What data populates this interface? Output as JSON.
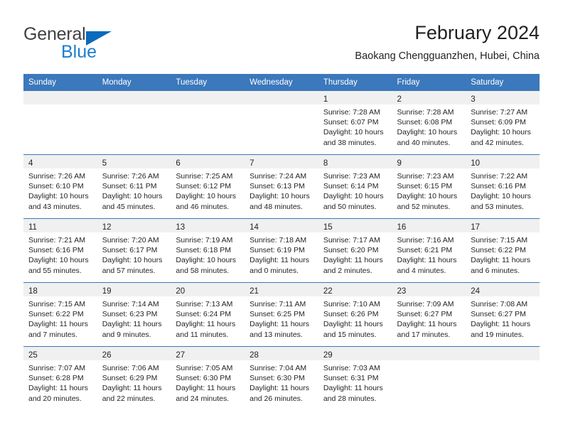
{
  "brand": {
    "name_part1": "General",
    "name_part2": "Blue",
    "triangle_color": "#0a6bbd",
    "blue_color": "#1a7ed0",
    "gray_color": "#414042"
  },
  "header": {
    "title": "February 2024",
    "subtitle": "Baokang Chengguanzhen, Hubei, China",
    "accent_color": "#3b78bc"
  },
  "weekday_headers": [
    "Sunday",
    "Monday",
    "Tuesday",
    "Wednesday",
    "Thursday",
    "Friday",
    "Saturday"
  ],
  "weeks": [
    [
      {
        "day": "",
        "lines": [],
        "empty": true
      },
      {
        "day": "",
        "lines": [],
        "empty": true
      },
      {
        "day": "",
        "lines": [],
        "empty": true
      },
      {
        "day": "",
        "lines": [],
        "empty": true
      },
      {
        "day": "1",
        "lines": [
          "Sunrise: 7:28 AM",
          "Sunset: 6:07 PM",
          "Daylight: 10 hours",
          "and 38 minutes."
        ],
        "empty": false
      },
      {
        "day": "2",
        "lines": [
          "Sunrise: 7:28 AM",
          "Sunset: 6:08 PM",
          "Daylight: 10 hours",
          "and 40 minutes."
        ],
        "empty": false
      },
      {
        "day": "3",
        "lines": [
          "Sunrise: 7:27 AM",
          "Sunset: 6:09 PM",
          "Daylight: 10 hours",
          "and 42 minutes."
        ],
        "empty": false
      }
    ],
    [
      {
        "day": "4",
        "lines": [
          "Sunrise: 7:26 AM",
          "Sunset: 6:10 PM",
          "Daylight: 10 hours",
          "and 43 minutes."
        ],
        "empty": false
      },
      {
        "day": "5",
        "lines": [
          "Sunrise: 7:26 AM",
          "Sunset: 6:11 PM",
          "Daylight: 10 hours",
          "and 45 minutes."
        ],
        "empty": false
      },
      {
        "day": "6",
        "lines": [
          "Sunrise: 7:25 AM",
          "Sunset: 6:12 PM",
          "Daylight: 10 hours",
          "and 46 minutes."
        ],
        "empty": false
      },
      {
        "day": "7",
        "lines": [
          "Sunrise: 7:24 AM",
          "Sunset: 6:13 PM",
          "Daylight: 10 hours",
          "and 48 minutes."
        ],
        "empty": false
      },
      {
        "day": "8",
        "lines": [
          "Sunrise: 7:23 AM",
          "Sunset: 6:14 PM",
          "Daylight: 10 hours",
          "and 50 minutes."
        ],
        "empty": false
      },
      {
        "day": "9",
        "lines": [
          "Sunrise: 7:23 AM",
          "Sunset: 6:15 PM",
          "Daylight: 10 hours",
          "and 52 minutes."
        ],
        "empty": false
      },
      {
        "day": "10",
        "lines": [
          "Sunrise: 7:22 AM",
          "Sunset: 6:16 PM",
          "Daylight: 10 hours",
          "and 53 minutes."
        ],
        "empty": false
      }
    ],
    [
      {
        "day": "11",
        "lines": [
          "Sunrise: 7:21 AM",
          "Sunset: 6:16 PM",
          "Daylight: 10 hours",
          "and 55 minutes."
        ],
        "empty": false
      },
      {
        "day": "12",
        "lines": [
          "Sunrise: 7:20 AM",
          "Sunset: 6:17 PM",
          "Daylight: 10 hours",
          "and 57 minutes."
        ],
        "empty": false
      },
      {
        "day": "13",
        "lines": [
          "Sunrise: 7:19 AM",
          "Sunset: 6:18 PM",
          "Daylight: 10 hours",
          "and 58 minutes."
        ],
        "empty": false
      },
      {
        "day": "14",
        "lines": [
          "Sunrise: 7:18 AM",
          "Sunset: 6:19 PM",
          "Daylight: 11 hours",
          "and 0 minutes."
        ],
        "empty": false
      },
      {
        "day": "15",
        "lines": [
          "Sunrise: 7:17 AM",
          "Sunset: 6:20 PM",
          "Daylight: 11 hours",
          "and 2 minutes."
        ],
        "empty": false
      },
      {
        "day": "16",
        "lines": [
          "Sunrise: 7:16 AM",
          "Sunset: 6:21 PM",
          "Daylight: 11 hours",
          "and 4 minutes."
        ],
        "empty": false
      },
      {
        "day": "17",
        "lines": [
          "Sunrise: 7:15 AM",
          "Sunset: 6:22 PM",
          "Daylight: 11 hours",
          "and 6 minutes."
        ],
        "empty": false
      }
    ],
    [
      {
        "day": "18",
        "lines": [
          "Sunrise: 7:15 AM",
          "Sunset: 6:22 PM",
          "Daylight: 11 hours",
          "and 7 minutes."
        ],
        "empty": false
      },
      {
        "day": "19",
        "lines": [
          "Sunrise: 7:14 AM",
          "Sunset: 6:23 PM",
          "Daylight: 11 hours",
          "and 9 minutes."
        ],
        "empty": false
      },
      {
        "day": "20",
        "lines": [
          "Sunrise: 7:13 AM",
          "Sunset: 6:24 PM",
          "Daylight: 11 hours",
          "and 11 minutes."
        ],
        "empty": false
      },
      {
        "day": "21",
        "lines": [
          "Sunrise: 7:11 AM",
          "Sunset: 6:25 PM",
          "Daylight: 11 hours",
          "and 13 minutes."
        ],
        "empty": false
      },
      {
        "day": "22",
        "lines": [
          "Sunrise: 7:10 AM",
          "Sunset: 6:26 PM",
          "Daylight: 11 hours",
          "and 15 minutes."
        ],
        "empty": false
      },
      {
        "day": "23",
        "lines": [
          "Sunrise: 7:09 AM",
          "Sunset: 6:27 PM",
          "Daylight: 11 hours",
          "and 17 minutes."
        ],
        "empty": false
      },
      {
        "day": "24",
        "lines": [
          "Sunrise: 7:08 AM",
          "Sunset: 6:27 PM",
          "Daylight: 11 hours",
          "and 19 minutes."
        ],
        "empty": false
      }
    ],
    [
      {
        "day": "25",
        "lines": [
          "Sunrise: 7:07 AM",
          "Sunset: 6:28 PM",
          "Daylight: 11 hours",
          "and 20 minutes."
        ],
        "empty": false
      },
      {
        "day": "26",
        "lines": [
          "Sunrise: 7:06 AM",
          "Sunset: 6:29 PM",
          "Daylight: 11 hours",
          "and 22 minutes."
        ],
        "empty": false
      },
      {
        "day": "27",
        "lines": [
          "Sunrise: 7:05 AM",
          "Sunset: 6:30 PM",
          "Daylight: 11 hours",
          "and 24 minutes."
        ],
        "empty": false
      },
      {
        "day": "28",
        "lines": [
          "Sunrise: 7:04 AM",
          "Sunset: 6:30 PM",
          "Daylight: 11 hours",
          "and 26 minutes."
        ],
        "empty": false
      },
      {
        "day": "29",
        "lines": [
          "Sunrise: 7:03 AM",
          "Sunset: 6:31 PM",
          "Daylight: 11 hours",
          "and 28 minutes."
        ],
        "empty": false
      },
      {
        "day": "",
        "lines": [],
        "empty": true
      },
      {
        "day": "",
        "lines": [],
        "empty": true
      }
    ]
  ]
}
